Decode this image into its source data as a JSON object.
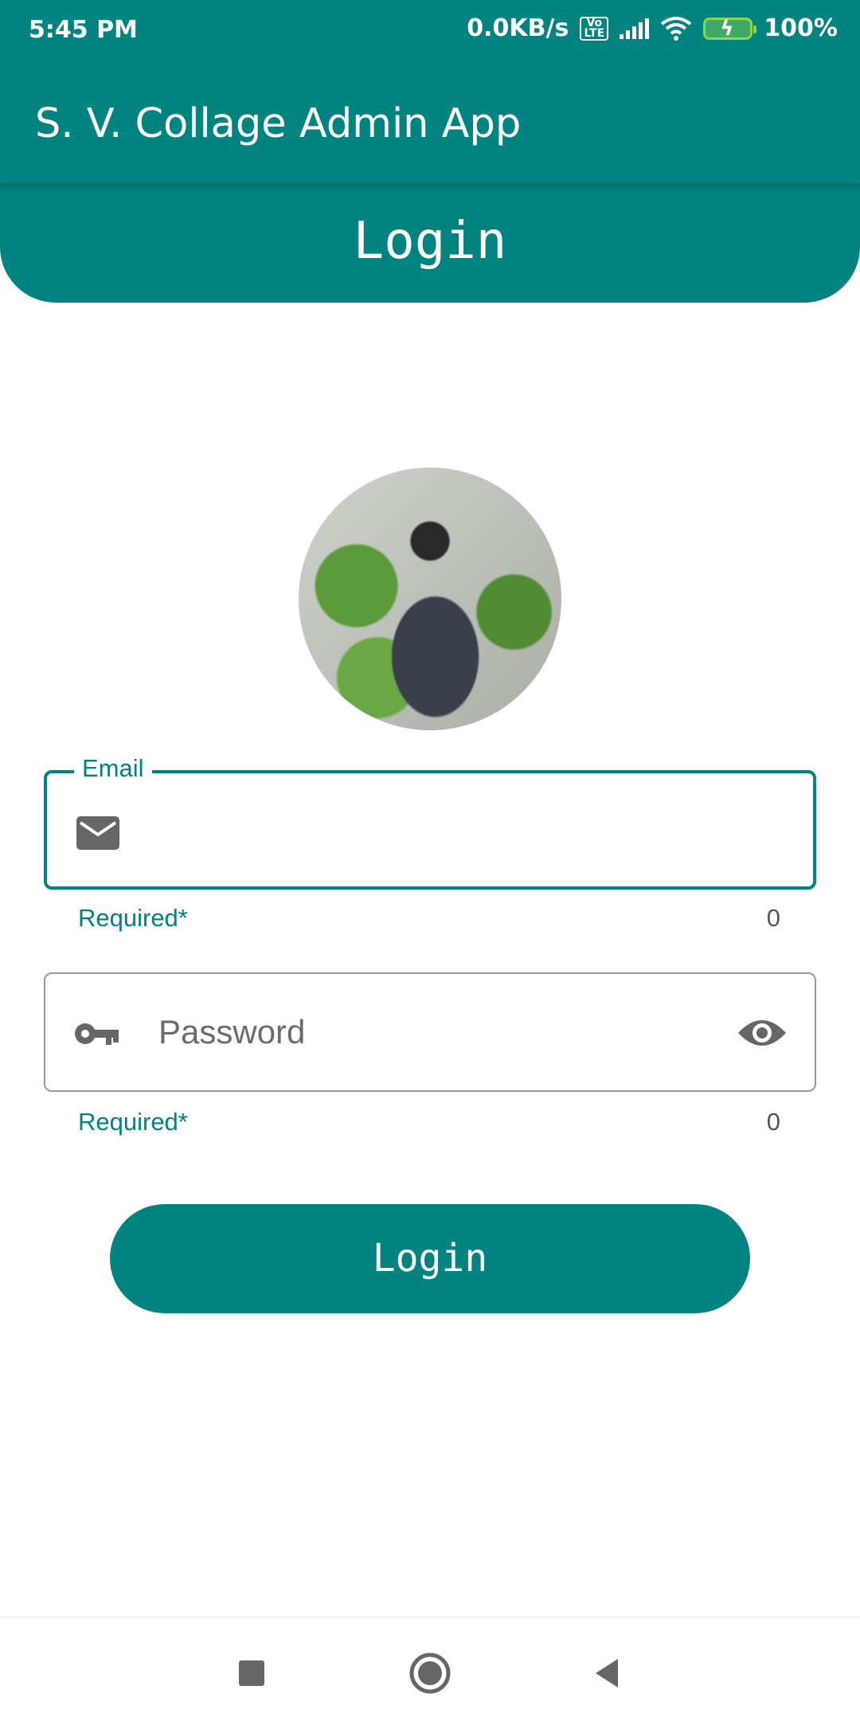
{
  "status_bar": {
    "time": "5:45 PM",
    "network_speed": "0.0KB/s",
    "volte_label": "Vo LTE",
    "battery_percent": "100%",
    "icons": [
      "volte-icon",
      "signal-icon",
      "wifi-icon",
      "battery-charging-icon"
    ]
  },
  "app_bar": {
    "title": "S. V. Collage Admin App"
  },
  "banner": {
    "title": "Login"
  },
  "avatar": {
    "alt": "profile-photo"
  },
  "email_field": {
    "label": "Email",
    "value": "",
    "placeholder": "",
    "helper": "Required*",
    "counter": "0",
    "icon": "mail-icon"
  },
  "password_field": {
    "label": "",
    "value": "",
    "placeholder": "Password",
    "helper": "Required*",
    "counter": "0",
    "icon": "key-icon",
    "toggle_icon": "eye-icon"
  },
  "login_button": {
    "label": "Login"
  },
  "nav_bar": {
    "icons": [
      "recents-icon",
      "home-icon",
      "back-icon"
    ]
  },
  "colors": {
    "primary": "#018380",
    "outline": "#9a9a9a",
    "text_secondary": "#555555"
  }
}
